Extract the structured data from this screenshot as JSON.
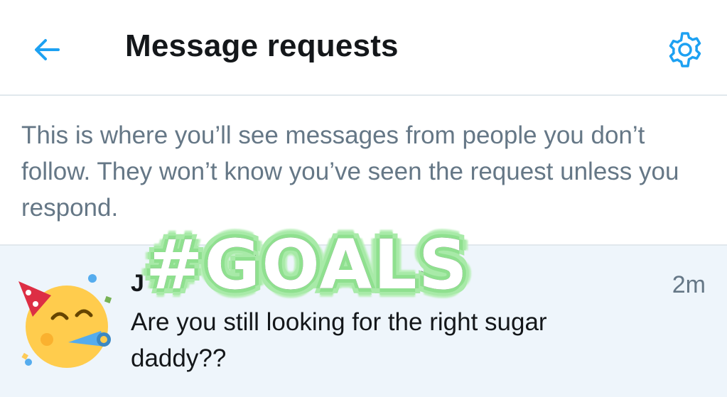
{
  "header": {
    "title": "Message requests",
    "back_icon": "arrow-left-icon",
    "settings_icon": "gear-icon",
    "accent_color": "#1da1f2"
  },
  "info_text": "This is where you’ll see messages from people you don’t follow. They won’t know you’ve seen the request unless you respond.",
  "request": {
    "sender_name": "J",
    "time": "2m",
    "preview": "Are you still looking for the right sugar daddy??",
    "avatar_icon": "partying-face-emoji-icon",
    "row_background": "#eef5fb"
  },
  "overlay": {
    "text": "#GOALS"
  }
}
